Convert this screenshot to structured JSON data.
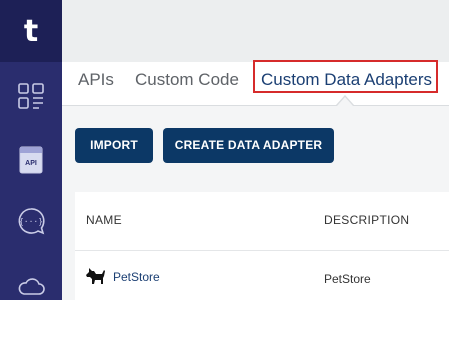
{
  "sidebar": {
    "logo_letter": "t",
    "items": [
      {
        "icon": "dashboard-icon"
      },
      {
        "icon": "api-document-icon",
        "badge": "API"
      },
      {
        "icon": "code-chat-icon",
        "badge": "{···}"
      },
      {
        "icon": "cloud-icon"
      }
    ]
  },
  "tabs": [
    {
      "label": "APIs",
      "active": false
    },
    {
      "label": "Custom Code",
      "active": false
    },
    {
      "label": "Custom Data Adapters",
      "active": true
    }
  ],
  "toolbar": {
    "import_label": "IMPORT",
    "create_label": "CREATE DATA ADAPTER"
  },
  "table": {
    "columns": [
      "NAME",
      "DESCRIPTION"
    ],
    "rows": [
      {
        "icon": "dog-icon",
        "name": "PetStore",
        "description": "PetStore"
      }
    ]
  },
  "colors": {
    "sidebar": "#2a2d6e",
    "logo_bg": "#1d2056",
    "button": "#0c3866",
    "active_tab": "#1b3f73",
    "highlight": "#d62b2b"
  }
}
